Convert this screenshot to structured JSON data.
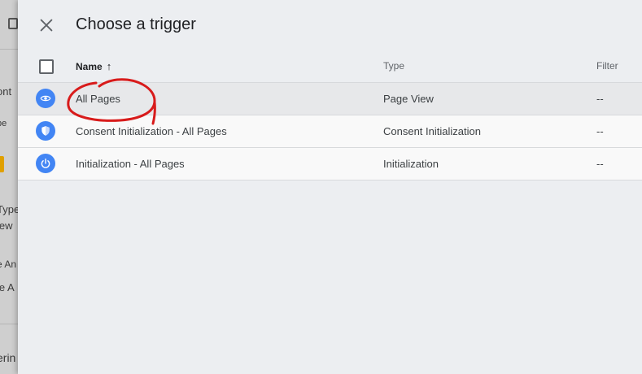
{
  "background": {
    "fragments": [
      "ont",
      "pe",
      "Type",
      "iew",
      "e An",
      "le A",
      "erin"
    ]
  },
  "header": {
    "close_icon": "close-icon",
    "title": "Choose a trigger"
  },
  "table": {
    "columns": {
      "name": "Name",
      "sort_indicator": "↑",
      "type": "Type",
      "filter": "Filter"
    },
    "rows": [
      {
        "icon": "eye-icon",
        "name": "All Pages",
        "type": "Page View",
        "filter": "--",
        "highlighted": true
      },
      {
        "icon": "shield-icon",
        "name": "Consent Initialization - All Pages",
        "type": "Consent Initialization",
        "filter": "--",
        "highlighted": false
      },
      {
        "icon": "power-icon",
        "name": "Initialization - All Pages",
        "type": "Initialization",
        "filter": "--",
        "highlighted": false
      }
    ]
  },
  "colors": {
    "icon_blue": "#4285f4",
    "annotation_red": "#d81b1b"
  }
}
